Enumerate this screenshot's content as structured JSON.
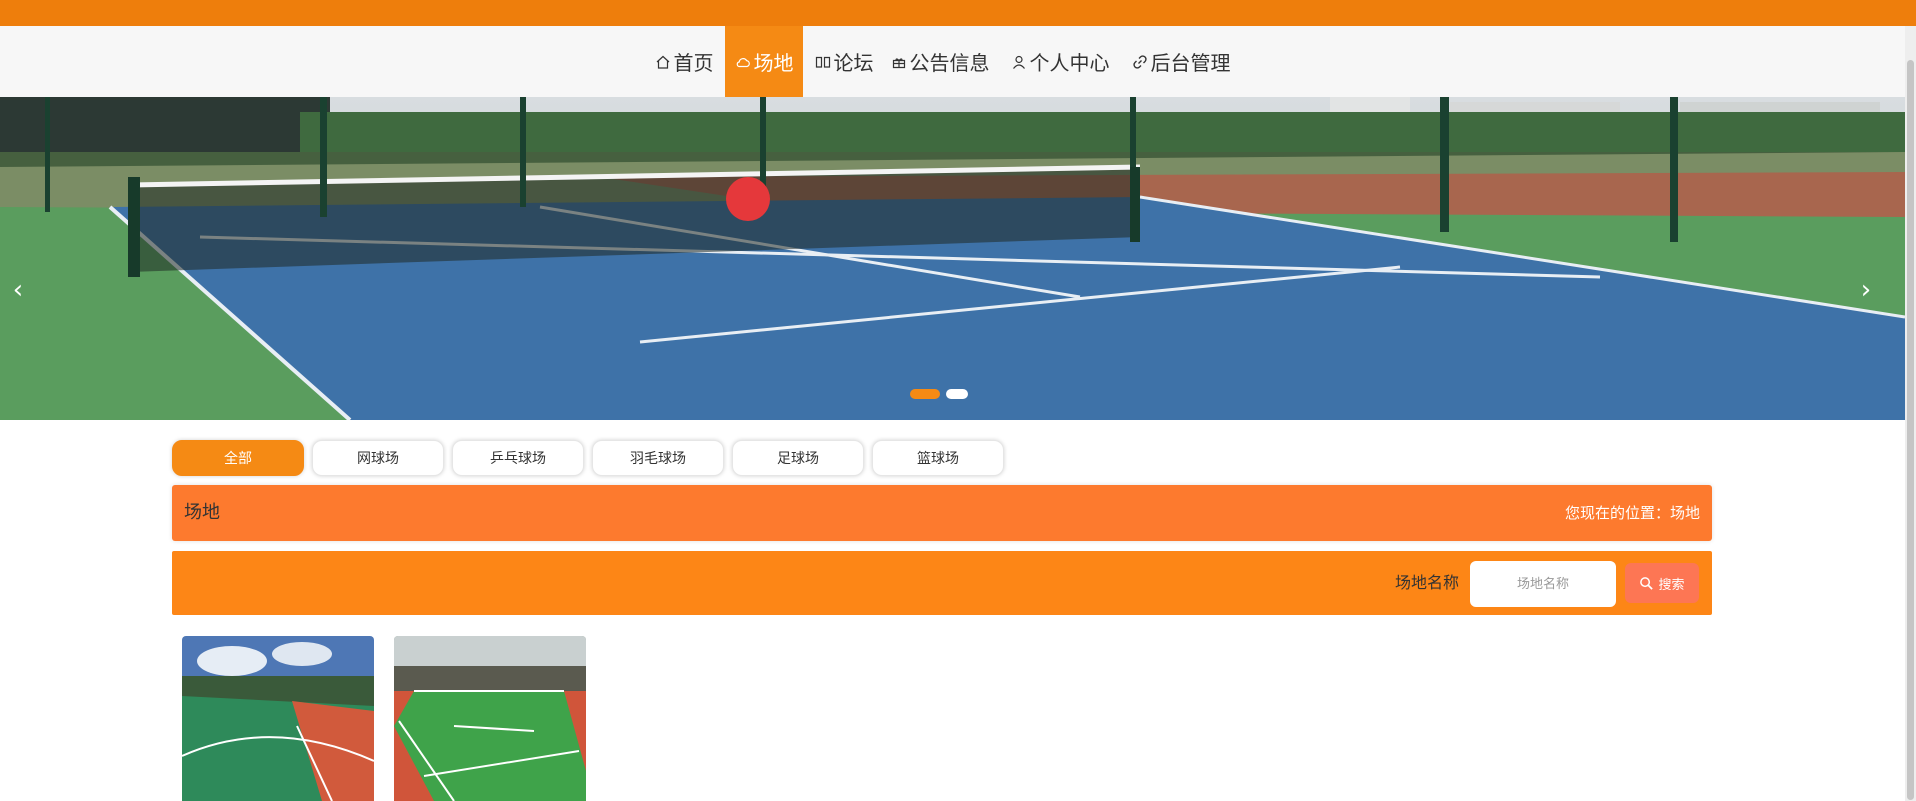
{
  "nav": {
    "items": [
      {
        "label": "首页",
        "icon": "home-icon"
      },
      {
        "label": "场地",
        "icon": "cloud-icon",
        "active": true
      },
      {
        "label": "论坛",
        "icon": "book-icon"
      },
      {
        "label": "公告信息",
        "icon": "gift-icon"
      },
      {
        "label": "个人中心",
        "icon": "user-icon"
      },
      {
        "label": "后台管理",
        "icon": "link-icon"
      }
    ]
  },
  "banner": {
    "prev_arrow": "‹",
    "next_arrow": "›",
    "slide_count": 2,
    "active_slide": 1
  },
  "categories": [
    "全部",
    "网球场",
    "乒乓球场",
    "羽毛球场",
    "足球场",
    "篮球场"
  ],
  "section": {
    "title": "场地",
    "location_label": "您现在的位置：场地"
  },
  "search": {
    "label": "场地名称",
    "placeholder": "场地名称",
    "button": "搜索"
  },
  "colors": {
    "accent": "#f58a14",
    "top_bar": "#ee7e0c",
    "section_bar": "#fd7a2e",
    "search_bar": "#fd8616",
    "search_button": "#fd7654"
  }
}
